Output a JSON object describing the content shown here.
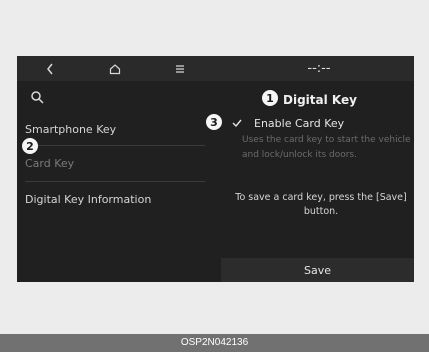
{
  "header": {
    "back_icon": "chevron-left-icon",
    "home_icon": "home-icon",
    "menu_icon": "menu-icon",
    "time": "--:--"
  },
  "sidebar": {
    "search_icon": "search-icon",
    "items": [
      {
        "label": "Smartphone Key"
      },
      {
        "label": "Card Key"
      },
      {
        "label": "Digital Key Information"
      }
    ]
  },
  "main": {
    "title": "Digital Key",
    "enable_card_key_label": "Enable Card Key",
    "description": "Uses the card key to start the vehicle and lock/unlock its doors.",
    "save_message": "To save a card key, press the [Save] button.",
    "save_button_label": "Save"
  },
  "callouts": [
    "1",
    "2",
    "3"
  ],
  "footer": {
    "code": "OSP2N042136"
  }
}
